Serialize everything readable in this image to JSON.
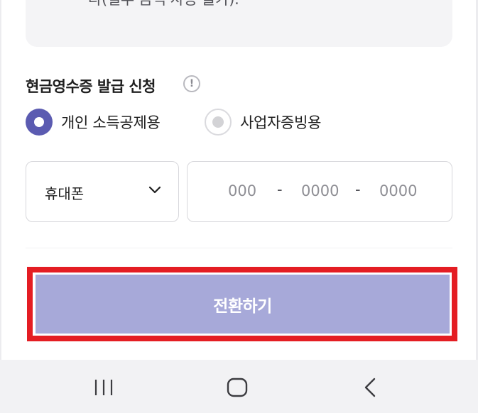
{
  "notice": {
    "text_fragment": "다(일부 금액 사용 불가)."
  },
  "cash_receipt": {
    "title": "현금영수증 발급 신청",
    "info_icon": "info-icon",
    "info_glyph": "!",
    "options": [
      {
        "label": "개인 소득공제용",
        "selected": true
      },
      {
        "label": "사업자증빙용",
        "selected": false
      }
    ],
    "id_type": {
      "value": "휴대폰",
      "icon": "chevron-down-icon"
    },
    "phone": {
      "part1_placeholder": "000",
      "part2_placeholder": "0000",
      "part3_placeholder": "0000",
      "separator": "-"
    }
  },
  "action": {
    "convert_label": "전환하기"
  },
  "system_nav": {
    "recent_icon": "recent-apps-icon",
    "home_icon": "home-icon",
    "back_icon": "back-icon"
  },
  "colors": {
    "accent": "#5b5bb1",
    "button_bg": "#a7a9d9",
    "highlight": "#e41d23",
    "nav_bg": "#f2f2f4"
  }
}
